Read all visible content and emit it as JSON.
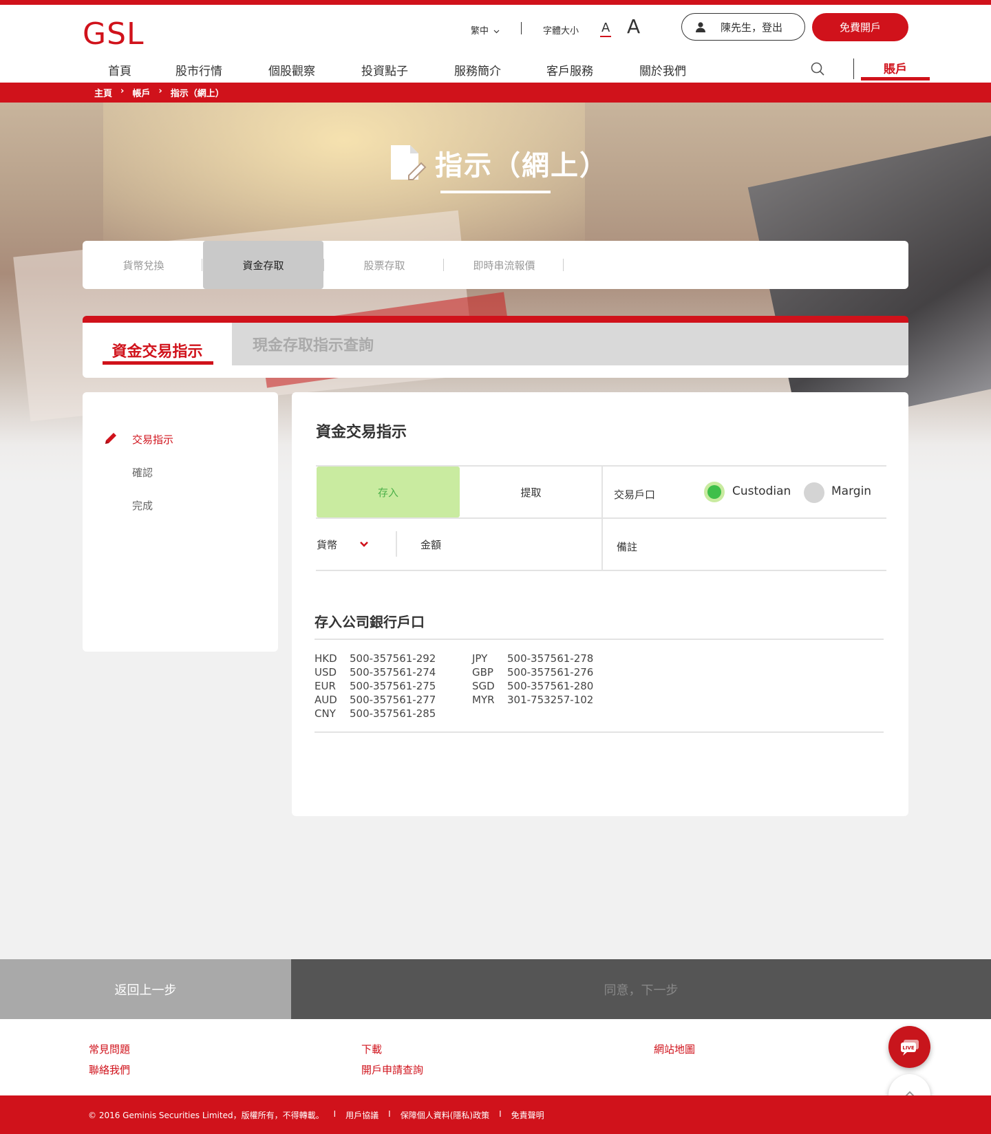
{
  "header": {
    "logo": "GSL",
    "language": "繁中",
    "font_size_label": "字體大小",
    "font_small": "A",
    "font_large": "A",
    "user_label": "陳先生，登出",
    "open_account": "免費開戶"
  },
  "nav": {
    "items": [
      "首頁",
      "股市行情",
      "個股觀察",
      "投資點子",
      "服務簡介",
      "客戶服務",
      "關於我們"
    ],
    "account": "賬戶"
  },
  "breadcrumb": [
    "主頁",
    "›",
    "帳戶",
    "›",
    "指示（網上）"
  ],
  "page_title": "指示（網上）",
  "sub_tabs": [
    "貨幣兌換",
    "資金存取",
    "股票存取",
    "即時串流報價"
  ],
  "main_tabs": [
    "資金交易指示",
    "現金存取指示查詢"
  ],
  "steps": [
    "交易指示",
    "確認",
    "完成"
  ],
  "form": {
    "title": "資金交易指示",
    "deposit": "存入",
    "withdraw": "提取",
    "account_label": "交易戶口",
    "custodian": "Custodian",
    "margin": "Margin",
    "currency": "貨幣",
    "amount": "金額",
    "remark": "備註"
  },
  "bank": {
    "title": "存入公司銀行戶口",
    "left": [
      {
        "cur": "HKD",
        "acct": "500-357561-292"
      },
      {
        "cur": "USD",
        "acct": "500-357561-274"
      },
      {
        "cur": "EUR",
        "acct": "500-357561-275"
      },
      {
        "cur": "AUD",
        "acct": "500-357561-277"
      },
      {
        "cur": "CNY",
        "acct": "500-357561-285"
      }
    ],
    "right": [
      {
        "cur": "JPY",
        "acct": "500-357561-278"
      },
      {
        "cur": "GBP",
        "acct": "500-357561-276"
      },
      {
        "cur": "SGD",
        "acct": "500-357561-280"
      },
      {
        "cur": "MYR",
        "acct": "301-753257-102"
      }
    ]
  },
  "actions": {
    "back": "返回上一步",
    "next": "同意，下一步"
  },
  "footer": {
    "faq": "常見問題",
    "contact": "聯絡我們",
    "download": "下載",
    "application_status": "開戶申請查詢",
    "sitemap": "網站地圖",
    "live": "LIVE",
    "copyright": "© 2016 Geminis Securities Limited，版權所有，不得轉載。",
    "terms": "用戶協議",
    "privacy": "保障個人資料(隱私)政策",
    "disclaimer": "免責聲明",
    "sep": "I"
  },
  "colors": {
    "brand_red": "#d0121b",
    "deposit_green_bg": "#c9eba0",
    "radio_green": "#3fbf4a"
  }
}
